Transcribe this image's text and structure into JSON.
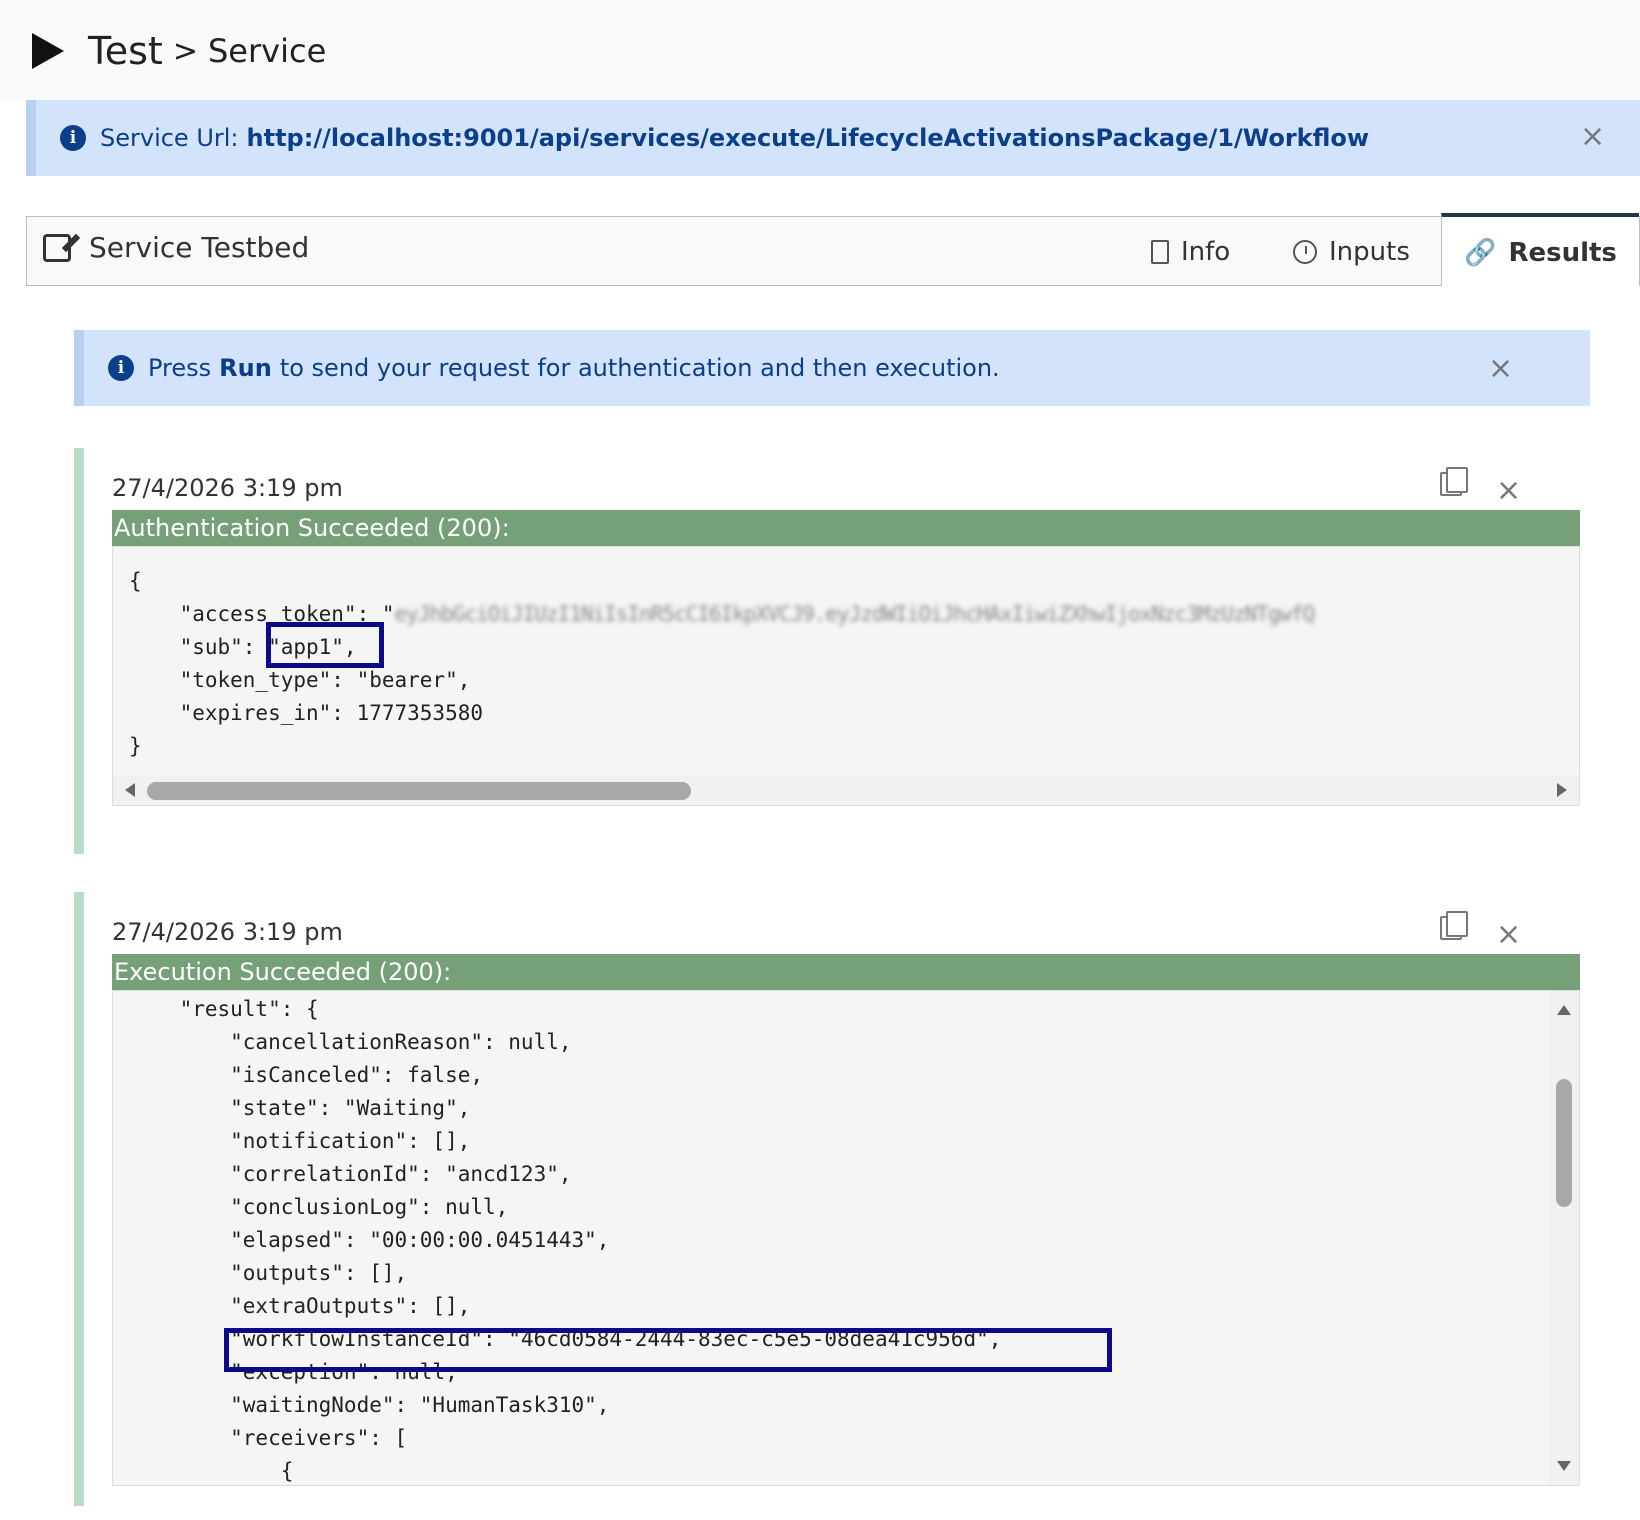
{
  "header": {
    "breadcrumb_root": "Test",
    "separator": ">",
    "breadcrumb_current": "Service"
  },
  "service_url": {
    "label": "Service Url:",
    "value": "http://localhost:9001/api/services/execute/LifecycleActivationsPackage/1/Workflow",
    "close": "×"
  },
  "panel": {
    "title": "Service Testbed",
    "tabs": [
      {
        "label": "Info",
        "icon": "file-icon"
      },
      {
        "label": "Inputs",
        "icon": "clock-icon"
      },
      {
        "label": "Results",
        "icon": "link-icon",
        "active": true
      }
    ]
  },
  "notice": {
    "prefix": "Press",
    "bold": "Run",
    "suffix": "to send your request for authentication and then execution.",
    "close": "×"
  },
  "results": [
    {
      "timestamp": "27/4/2026 3:19 pm",
      "status": "Authentication Succeeded (200):",
      "close": "×",
      "lines": {
        "open": "{",
        "access_token_key": "    \"access_token\": \"",
        "access_token_redacted": "eyJhbGciOiJIUzI1NiIsInR5cCI6IkpXVCJ9.eyJzdWIiOiJhcHAxIiwiZXhwIjoxNzc3MzUzNTgwfQ",
        "sub": "    \"sub\": \"app1\",",
        "token_type": "    \"token_type\": \"bearer\",",
        "expires_in": "    \"expires_in\": 1777353580",
        "close": "}"
      }
    },
    {
      "timestamp": "27/4/2026 3:19 pm",
      "status": "Execution Succeeded (200):",
      "close": "×",
      "code": "    \"result\": {\n        \"cancellationReason\": null,\n        \"isCanceled\": false,\n        \"state\": \"Waiting\",\n        \"notification\": [],\n        \"correlationId\": \"ancd123\",\n        \"conclusionLog\": null,\n        \"elapsed\": \"00:00:00.0451443\",\n        \"outputs\": [],\n        \"extraOutputs\": [],\n        \"workflowInstanceId\": \"46cd0584-2444-83ec-c5e5-08dea41c956d\",\n        \"exception\": null,\n        \"waitingNode\": \"HumanTask310\",\n        \"receivers\": [\n            {"
    }
  ],
  "colors": {
    "info_bg": "#d3e3fb",
    "info_text": "#0b3f8a",
    "success_bar": "#76a077",
    "result_border": "#b7dcc8",
    "highlight": "#0a0a8a"
  }
}
